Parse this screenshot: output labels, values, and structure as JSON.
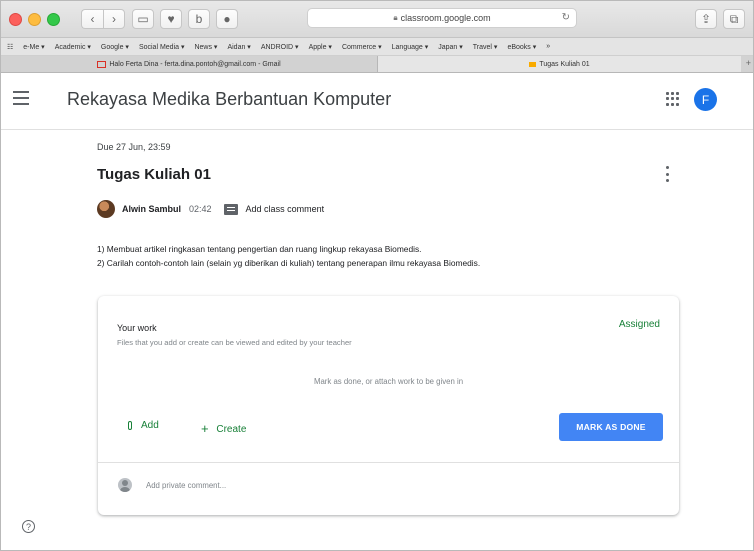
{
  "browser": {
    "url": "classroom.google.com",
    "nav_back": "‹",
    "nav_forward": "›",
    "bookmarks": [
      "e-Me ▾",
      "Academic ▾",
      "Google ▾",
      "Social Media ▾",
      "News ▾",
      "Aidan ▾",
      "ANDROID ▾",
      "Apple ▾",
      "Commerce ▾",
      "Language ▾",
      "Japan ▾",
      "Travel ▾",
      "eBooks ▾",
      "»"
    ],
    "tabs": [
      {
        "label": "Halo Ferta Dina - ferta.dina.pontoh@gmail.com - Gmail",
        "icon": "gmail-icon",
        "active": false
      },
      {
        "label": "Tugas Kuliah 01",
        "icon": "classroom-icon",
        "active": true
      }
    ],
    "new_tab": "+"
  },
  "header": {
    "class_name": "Rekayasa Medika Berbantuan Komputer",
    "avatar_letter": "F"
  },
  "assignment": {
    "due": "Due 27 Jun, 23:59",
    "title": "Tugas Kuliah 01",
    "author": "Alwin Sambul",
    "time": "02:42",
    "comment_link": "Add class comment",
    "instructions": [
      "1) Membuat artikel ringkasan tentang pengertian dan ruang lingkup rekayasa Biomedis.",
      "2) Carilah contoh-contoh lain (selain yg diberikan di kuliah) tentang penerapan ilmu rekayasa Biomedis."
    ]
  },
  "your_work": {
    "title": "Your work",
    "subtitle": "Files that you add or create can be viewed and edited by your teacher",
    "status": "Assigned",
    "hint": "Mark as done, or attach work to be given in",
    "add_label": "Add",
    "create_label": "Create",
    "mark_done_label": "MARK AS DONE",
    "private_comment_placeholder": "Add private comment..."
  },
  "help_symbol": "?",
  "colors": {
    "accent_green": "#188038",
    "button_blue": "#4285f4",
    "avatar_blue": "#1a73e8"
  }
}
